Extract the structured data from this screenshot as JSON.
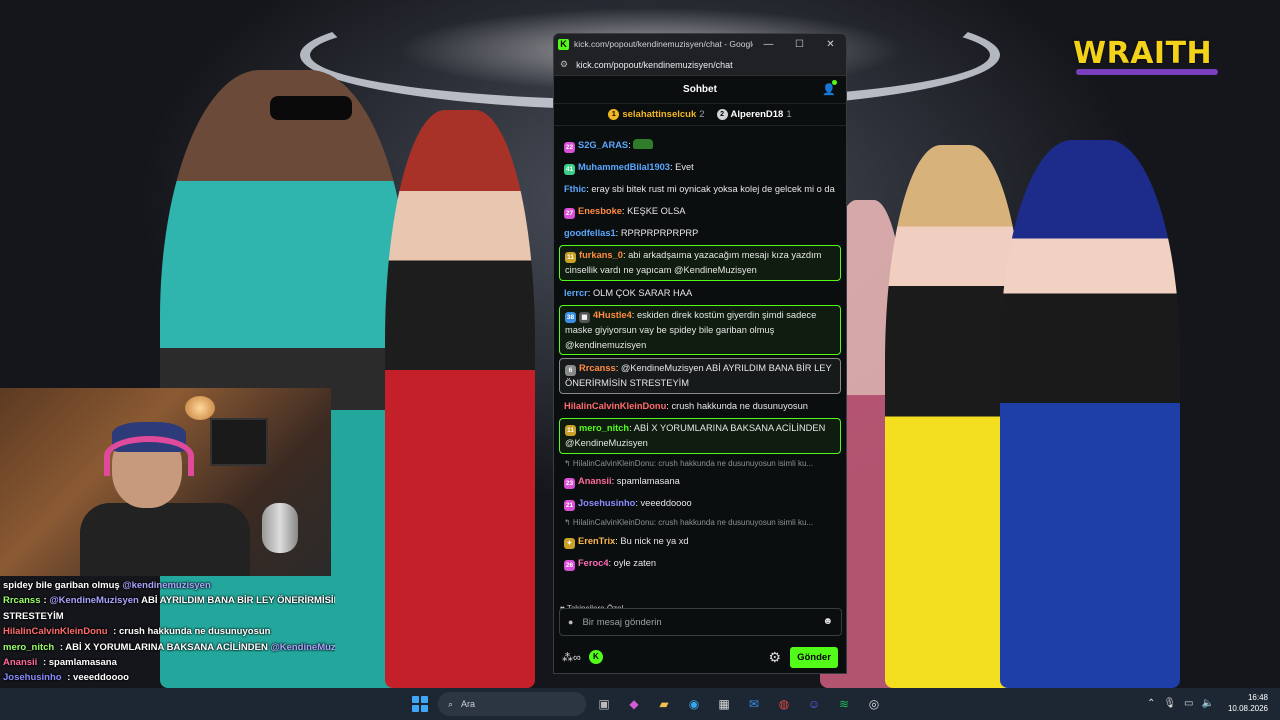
{
  "overlay": {
    "brand": "WRAITH",
    "chat_lines": [
      {
        "user": "",
        "user_color": "#ffffff",
        "parts": [
          {
            "t": "spidey bile gariban olmuş "
          },
          {
            "t": "@kendinemuzisyen",
            "m": true
          }
        ]
      },
      {
        "user": "Rrcanss",
        "user_color": "#9aff6a",
        "parts": [
          {
            "t": ": "
          },
          {
            "t": "@KendineMuzisyen",
            "m": true
          },
          {
            "t": " ABİ AYRILDIM BANA BİR LEY ÖNERİRMİSİN"
          }
        ]
      },
      {
        "user": "",
        "user_color": "#ffffff",
        "parts": [
          {
            "t": "STRESTEYİM"
          }
        ]
      },
      {
        "user": "HilalinCalvinKleinDonu",
        "user_color": "#ff6b6b",
        "parts": [
          {
            "t": " : crush hakkunda ne dusunuyosun"
          }
        ]
      },
      {
        "user": "mero_nitch",
        "user_color": "#9aff6a",
        "parts": [
          {
            "t": " : ABİ X YORUMLARINA BAKSANA ACİLİNDEN "
          },
          {
            "t": "@KendineMuzisyen",
            "m": true
          }
        ]
      },
      {
        "user": "Anansii",
        "user_color": "#ff6b9a",
        "parts": [
          {
            "t": " : spamlamasana"
          }
        ]
      },
      {
        "user": "Josehusinho",
        "user_color": "#8a8cff",
        "parts": [
          {
            "t": " : veeeddoooo"
          }
        ]
      },
      {
        "user": "ErenTrix",
        "user_color": "#ffb84d",
        "parts": [
          {
            "t": " : Bu nick ne ya xd"
          }
        ]
      },
      {
        "user": "Feroc4",
        "user_color": "#ff6bb5",
        "parts": [
          {
            "t": " : oyle zaten"
          }
        ]
      }
    ]
  },
  "browser": {
    "title": "kick.com/popout/kendinemuzisyen/chat - Google...",
    "url": "kick.com/popout/kendinemuzisyen/chat",
    "minimize": "—",
    "maximize": "☐",
    "close": "✕"
  },
  "chat": {
    "header": "Sohbet",
    "leaderboard": [
      {
        "rank": "1",
        "name": "selahattinselcuk",
        "count": "2",
        "rank_color": "#f2b622",
        "name_color": "#f2b622"
      },
      {
        "rank": "2",
        "name": "AlperenD18",
        "count": "1",
        "rank_color": "#cfd2d6",
        "name_color": "#ffffff"
      }
    ],
    "messages": [
      {
        "badges": [
          {
            "t": "22",
            "c": "#d94fd5"
          }
        ],
        "user": "S2G_ARAS",
        "color": "#5aa7ff",
        "text": "",
        "emote": true,
        "style": ""
      },
      {
        "badges": [
          {
            "t": "41",
            "c": "#3ccf8a"
          }
        ],
        "user": "MuhammedBilal1903",
        "color": "#5aa7ff",
        "text": "Evet",
        "style": ""
      },
      {
        "badges": [],
        "user": "Fthic",
        "color": "#5aa7ff",
        "text": "eray sbi bitek rust mi oynicak yoksa kolej de gelcek mi o da",
        "style": ""
      },
      {
        "badges": [
          {
            "t": "27",
            "c": "#d94fd5"
          }
        ],
        "user": "Enesboke",
        "color": "#ff8c42",
        "text": "KEŞKE OLSA",
        "style": ""
      },
      {
        "badges": [],
        "user": "goodfellas1",
        "color": "#5aa7ff",
        "text": "RPRPRPRPRPRP",
        "style": ""
      },
      {
        "badges": [
          {
            "t": "11",
            "c": "#c9a227"
          }
        ],
        "user": "furkans_0",
        "color": "#ff8c42",
        "text": "abi arkadşaıma yazacağım mesajı kıza yazdım cinsellik vardı ne yapıcam @KendineMuzisyen",
        "style": "hl"
      },
      {
        "badges": [],
        "user": "lerrcr",
        "color": "#5aa7ff",
        "text": "OLM ÇOK SARAR HAA",
        "style": ""
      },
      {
        "badges": [
          {
            "t": "38",
            "c": "#3a8de0"
          },
          {
            "t": "▦",
            "c": "#555555"
          }
        ],
        "user": "4Hustle4",
        "color": "#ff8c42",
        "text": "eskiden direk kostüm giyerdin şimdi sadece maske giyiyorsun vay be spidey bile gariban olmuş @kendinemuzisyen",
        "style": "hl"
      },
      {
        "badges": [
          {
            "t": "6",
            "c": "#8a8a8a"
          }
        ],
        "user": "Rrcanss",
        "color": "#ff8c42",
        "text": "@KendineMuzisyen ABİ AYRILDIM BANA BİR LEY ÖNERİRMİSİN STRESTEYİM",
        "style": "hl2"
      },
      {
        "badges": [],
        "user": "HilalinCalvinKleinDonu",
        "color": "#ff6b6b",
        "text": "crush hakkunda ne dusunuyosun",
        "style": ""
      },
      {
        "badges": [
          {
            "t": "11",
            "c": "#c9a227"
          }
        ],
        "user": "mero_nitch",
        "color": "#53fc18",
        "text": "ABİ X YORUMLARINA BAKSANA ACİLİNDEN @KendineMuzisyen",
        "style": "hl"
      },
      {
        "reply": "↰ HilalinCalvinKleinDonu: crush hakkunda ne dusunuyosun isimli ku..."
      },
      {
        "badges": [
          {
            "t": "23",
            "c": "#d94fd5"
          }
        ],
        "user": "Anansii",
        "color": "#ff6b9a",
        "text": "spamlamasana",
        "style": ""
      },
      {
        "badges": [
          {
            "t": "21",
            "c": "#d94fd5"
          }
        ],
        "user": "Josehusinho",
        "color": "#8a8cff",
        "text": "veeeddoooo",
        "style": ""
      },
      {
        "reply": "↰ HilalinCalvinKleinDonu: crush hakkunda ne dusunuyosun isimli ku..."
      },
      {
        "badges": [
          {
            "t": "✦",
            "c": "#c9a227"
          }
        ],
        "user": "ErenTrix",
        "color": "#ffb84d",
        "text": "Bu nick ne ya xd",
        "style": ""
      },
      {
        "badges": [
          {
            "t": "26",
            "c": "#d94fd5"
          }
        ],
        "user": "Feroc4",
        "color": "#ff6bb5",
        "text": "oyle zaten",
        "style": ""
      }
    ],
    "emote_label": "♥ Takipçilere Özel",
    "input_placeholder": "Bir mesaj gönderin",
    "send_label": "Gönder"
  },
  "taskbar": {
    "search_label": "Ara",
    "time": "16:48",
    "date": "10.08.2026"
  }
}
